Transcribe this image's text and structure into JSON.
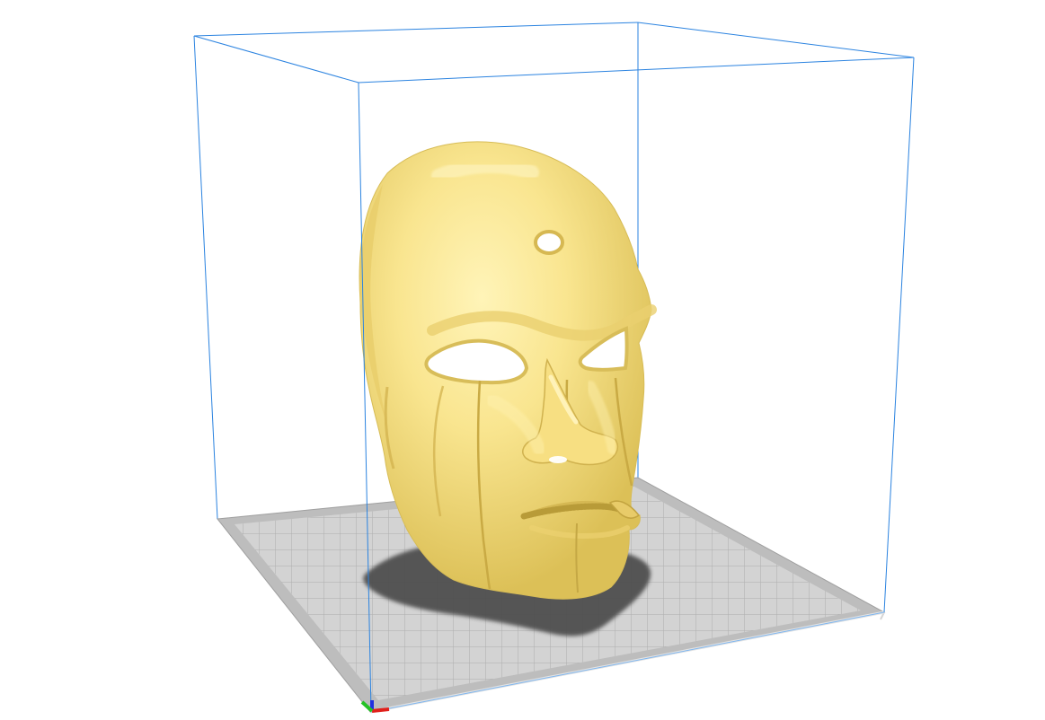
{
  "viewport": {
    "background_color": "#ffffff",
    "model_color": "#f9e58f",
    "model_highlight_color": "#fff6bf",
    "model_shade_color": "#d9bf55",
    "build_volume_color": "#1f78d8",
    "build_plate_color": "#d2d2d2",
    "build_plate_grid_color": "#a9a9a9",
    "build_plate_border_color": "#bdbdbd",
    "shadow_color": "#4f4f4f"
  },
  "axes": {
    "x_color": "#e0201b",
    "y_color": "#25c225",
    "z_color": "#1f2fe0"
  },
  "model": {
    "icon": "face-mask-model-icon"
  }
}
